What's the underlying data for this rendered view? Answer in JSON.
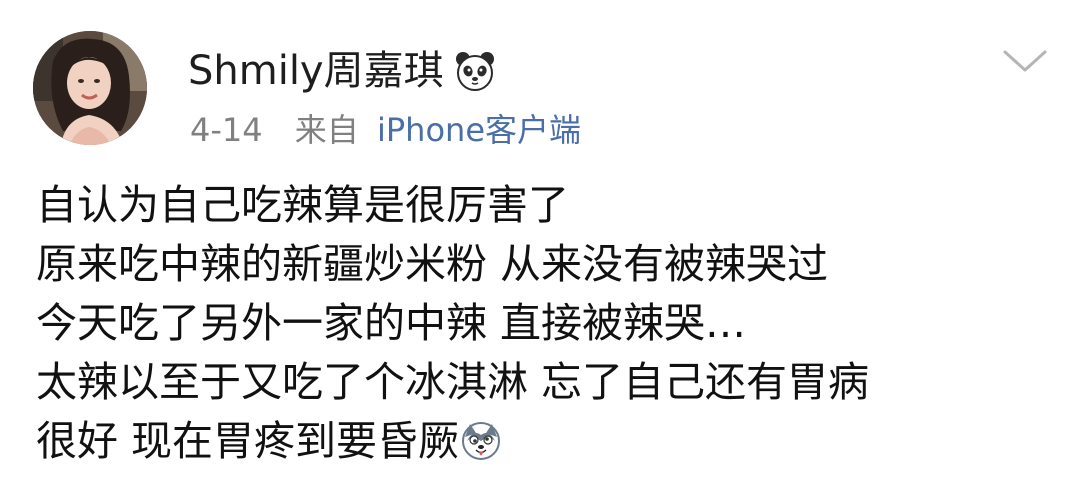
{
  "post": {
    "username": "Shmily周嘉琪",
    "username_badge_icon": "panda-emoji-icon",
    "date": "4-14",
    "source_prefix": "来自",
    "source_client": "iPhone客户端",
    "menu_icon": "chevron-down-icon",
    "text_lines": [
      "自认为自己吃辣算是很厉害了",
      "原来吃中辣的新疆炒米粉 从来没有被辣哭过",
      "今天吃了另外一家的中辣 直接被辣哭…",
      "太辣以至于又吃了个冰淇淋 忘了自己还有胃病",
      "很好 现在胃疼到要昏厥"
    ],
    "trailing_emoji_icon": "husky-emoji-icon"
  },
  "colors": {
    "username": "#1e1e1e",
    "meta_gray": "#808080",
    "link_blue": "#4a6fa8",
    "body_text": "#111111"
  }
}
